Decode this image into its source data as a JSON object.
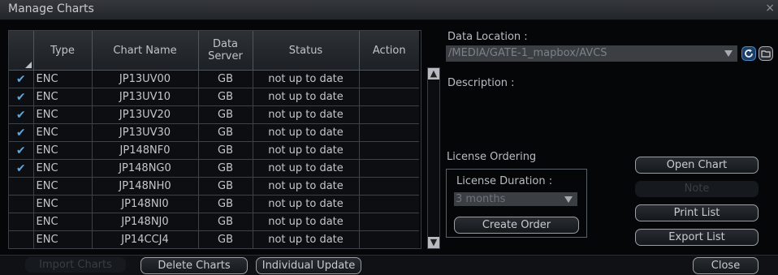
{
  "window": {
    "title": "Manage Charts",
    "close_label": "×"
  },
  "table": {
    "headers": [
      "",
      "Type",
      "Chart Name",
      "Data Server",
      "Status",
      "Action"
    ],
    "header_data_server_lines": [
      "Data",
      "Server"
    ],
    "rows": [
      {
        "checked": true,
        "type": "ENC",
        "name": "JP13UV00",
        "server": "GB",
        "status": "not up to date",
        "action": ""
      },
      {
        "checked": true,
        "type": "ENC",
        "name": "JP13UV10",
        "server": "GB",
        "status": "not up to date",
        "action": ""
      },
      {
        "checked": true,
        "type": "ENC",
        "name": "JP13UV20",
        "server": "GB",
        "status": "not up to date",
        "action": ""
      },
      {
        "checked": true,
        "type": "ENC",
        "name": "JP13UV30",
        "server": "GB",
        "status": "not up to date",
        "action": ""
      },
      {
        "checked": true,
        "type": "ENC",
        "name": "JP148NF0",
        "server": "GB",
        "status": "not up to date",
        "action": ""
      },
      {
        "checked": true,
        "type": "ENC",
        "name": "JP148NG0",
        "server": "GB",
        "status": "not up to date",
        "action": ""
      },
      {
        "checked": false,
        "type": "ENC",
        "name": "JP148NH0",
        "server": "GB",
        "status": "not up to date",
        "action": ""
      },
      {
        "checked": false,
        "type": "ENC",
        "name": "JP148NI0",
        "server": "GB",
        "status": "not up to date",
        "action": ""
      },
      {
        "checked": false,
        "type": "ENC",
        "name": "JP148NJ0",
        "server": "GB",
        "status": "not up to date",
        "action": ""
      },
      {
        "checked": false,
        "type": "ENC",
        "name": "JP14CCJ4",
        "server": "GB",
        "status": "not up to date",
        "action": ""
      }
    ],
    "check_glyph": "✔"
  },
  "right": {
    "data_location_label": "Data Location :",
    "data_location_value": "/MEDIA/GATE-1_mapbox/AVCS",
    "description_label": "Description :",
    "license_ordering_label": "License Ordering",
    "license_duration_label": "License Duration :",
    "license_duration_value": "3 months",
    "create_order_label": "Create Order",
    "open_chart_label": "Open Chart",
    "note_label": "Note",
    "print_list_label": "Print List",
    "export_list_label": "Export List",
    "refresh_icon": "refresh-icon",
    "folder_icon": "folder-icon"
  },
  "bottom": {
    "import_label": "Import Charts",
    "delete_label": "Delete Charts",
    "individual_update_label": "Individual Update",
    "close_label": "Close"
  },
  "colors": {
    "accent": "#2f7fd0",
    "check": "#5aa9e0"
  }
}
